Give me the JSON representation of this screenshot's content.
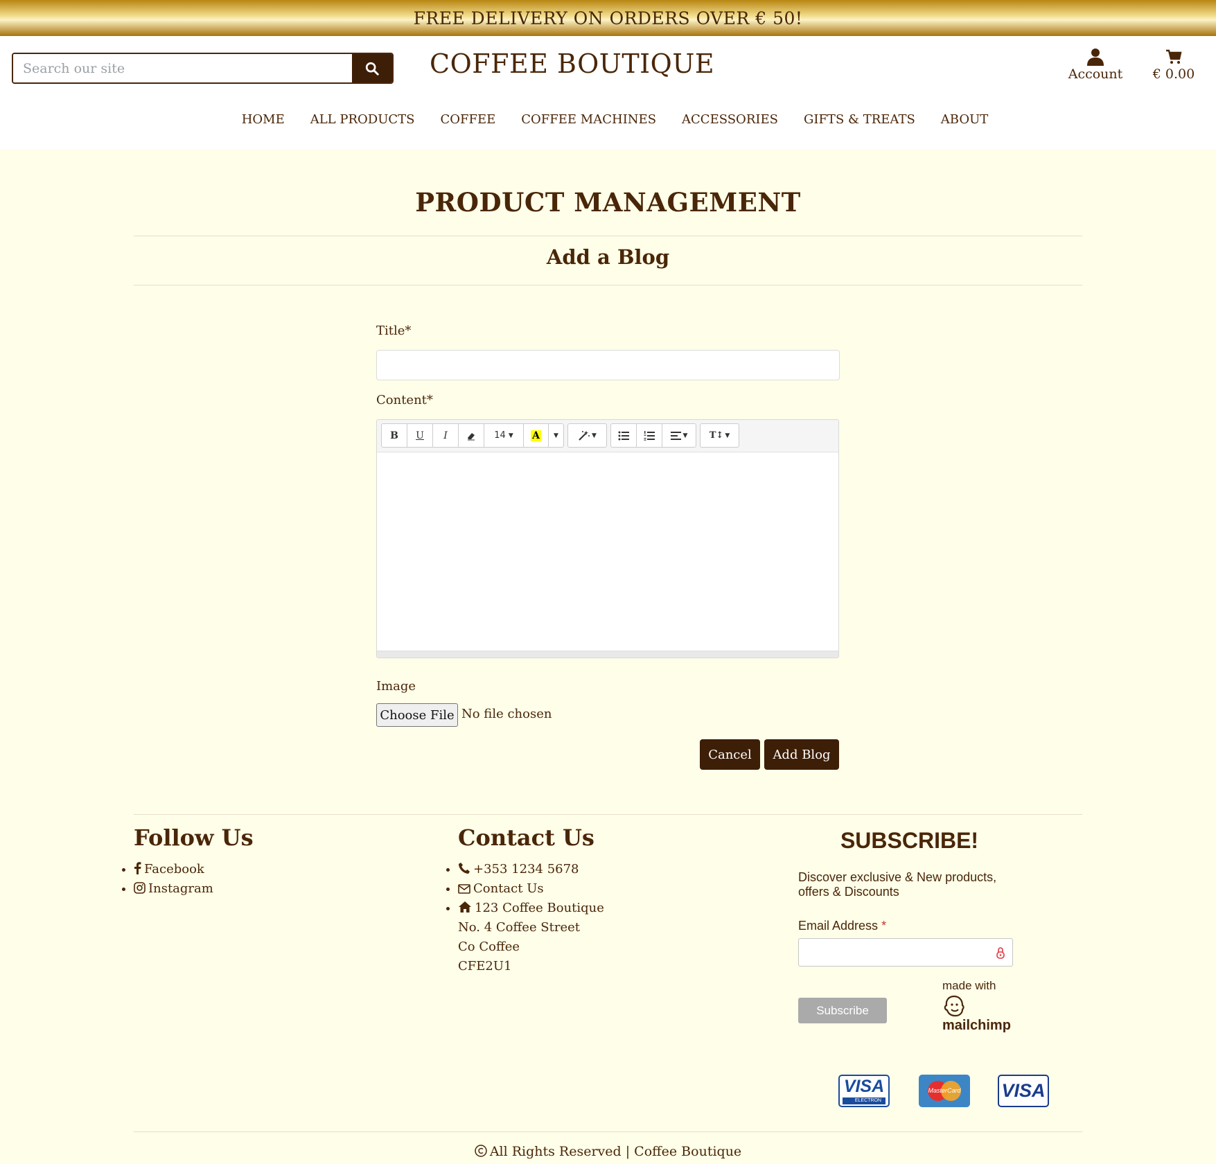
{
  "banner": {
    "text": "FREE DELIVERY ON ORDERS OVER € 50!"
  },
  "header": {
    "search_placeholder": "Search our site",
    "search_icon": "search-icon",
    "brand": "COFFEE BOUTIQUE",
    "account_label": "Account",
    "account_icon": "user-icon",
    "cart_label": "€ 0.00",
    "cart_icon": "cart-icon"
  },
  "nav": {
    "items": [
      "HOME",
      "ALL PRODUCTS",
      "COFFEE",
      "COFFEE MACHINES",
      "ACCESSORIES",
      "GIFTS & TREATS",
      "ABOUT"
    ]
  },
  "page": {
    "title": "PRODUCT MANAGEMENT",
    "subtitle": "Add a Blog"
  },
  "form": {
    "title_label": "Title*",
    "title_value": "",
    "content_label": "Content*",
    "toolbar": {
      "bold": "B",
      "underline": "U",
      "italic": "I",
      "eraser_icon": "eraser-icon",
      "font_size": "14",
      "color_label": "A",
      "style_icon": "magic-icon",
      "ul_icon": "unordered-list-icon",
      "ol_icon": "ordered-list-icon",
      "align_icon": "align-icon",
      "line_height_label": "T↕"
    },
    "image_label": "Image",
    "file_button": "Choose File",
    "file_status": "No file chosen",
    "cancel": "Cancel",
    "submit": "Add Blog"
  },
  "footer": {
    "follow": {
      "title": "Follow Us",
      "facebook": "Facebook",
      "instagram": "Instagram"
    },
    "contact": {
      "title": "Contact Us",
      "phone": "+353 1234 5678",
      "contact_link": "Contact Us",
      "address_lines": [
        "123 Coffee Boutique",
        "No. 4 Coffee Street",
        "Co Coffee",
        "CFE2U1"
      ]
    },
    "subscribe": {
      "title": "SUBSCRIBE!",
      "text": "Discover exclusive & New products, offers & Discounts",
      "email_label": "Email Address",
      "required_mark": "*",
      "button": "Subscribe",
      "made_with": "made with",
      "mailchimp": "mailchimp"
    },
    "cards": [
      "VISA",
      "MasterCard",
      "VISA"
    ],
    "card_subtext": "ELECTRON",
    "copyright": "All Rights Reserved | Coffee Boutique"
  },
  "colors": {
    "brown": "#4a2608",
    "dark_button": "#3d1e07",
    "page_bg": "#fefee9",
    "banner_gold": "#d4a82c"
  }
}
